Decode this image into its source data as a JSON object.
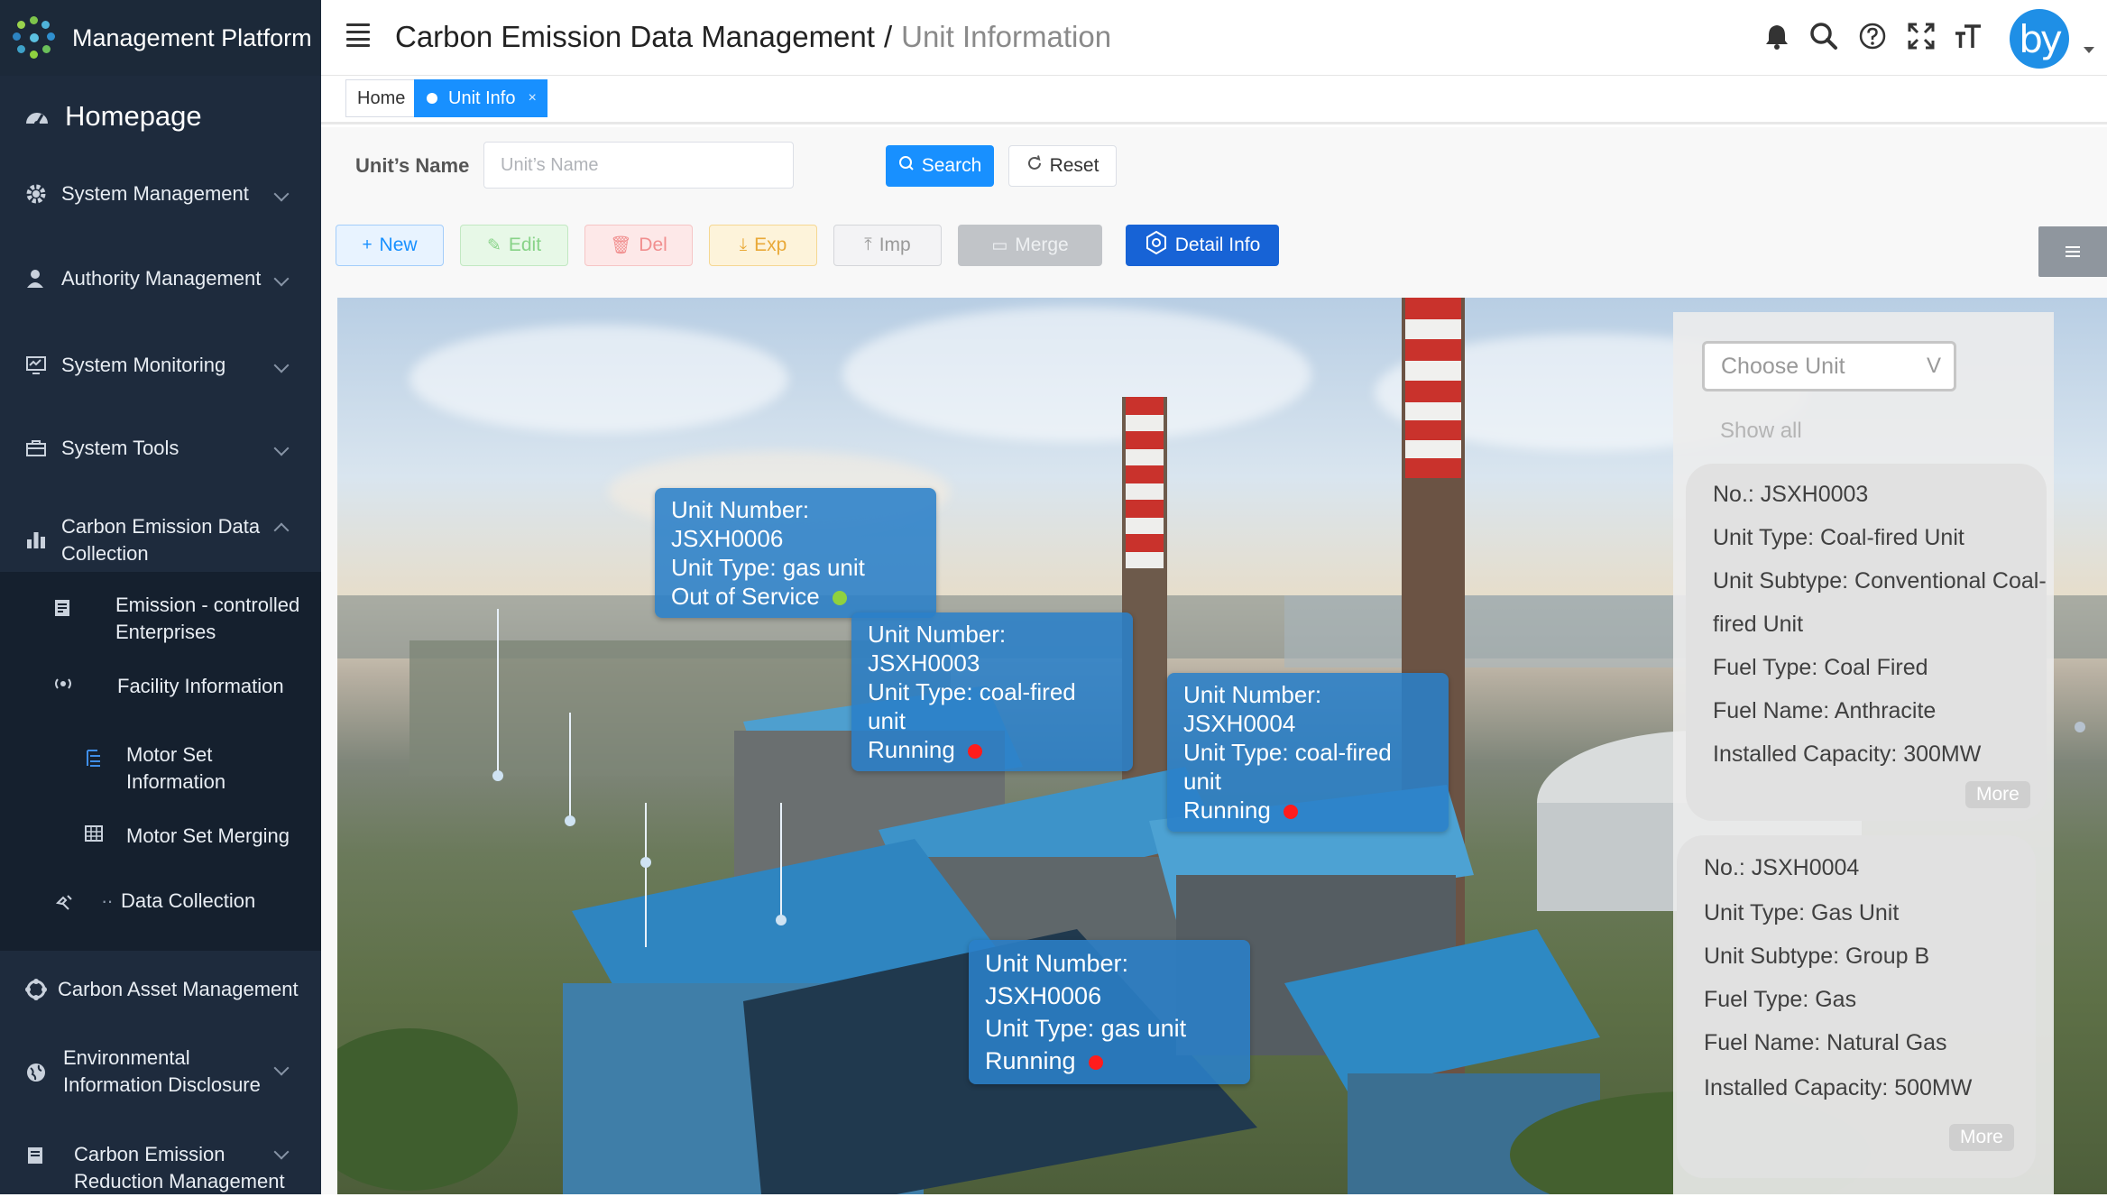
{
  "app": {
    "title": "Management Platform"
  },
  "sidebar": {
    "home": "Homepage",
    "items": [
      {
        "label": "System Management",
        "icon": "gear-icon"
      },
      {
        "label": "Authority Management",
        "icon": "user-icon"
      },
      {
        "label": "System Monitoring",
        "icon": "monitor-icon"
      },
      {
        "label": "System Tools",
        "icon": "toolbox-icon"
      },
      {
        "label": "Carbon Emission Data Collection",
        "icon": "bar-chart-icon"
      },
      {
        "label": "Carbon Asset Management",
        "icon": "asset-icon"
      },
      {
        "label": "Environmental Information Disclosure",
        "icon": "globe-icon"
      },
      {
        "label": "Carbon Emission Reduction Management",
        "icon": "report-icon"
      }
    ],
    "sub_items": [
      {
        "label": "Emission - controlled Enterprises",
        "icon": "enterprise-icon"
      },
      {
        "label": "Facility Information",
        "icon": "facility-icon"
      },
      {
        "label": "Motor Set Information",
        "icon": "list-icon"
      },
      {
        "label": "Motor Set Merging",
        "icon": "grid-icon"
      },
      {
        "label": "Data Collection",
        "icon": "collect-icon"
      }
    ]
  },
  "header": {
    "breadcrumb_parent": "Carbon Emission Data Management",
    "breadcrumb_sep": "/",
    "breadcrumb_current": "Unit Information",
    "avatar_text": "by"
  },
  "tags": {
    "home": "Home",
    "active": "Unit Info",
    "close": "×"
  },
  "query": {
    "label": "Unit’s Name",
    "placeholder": "Unit’s Name",
    "search": "Search",
    "reset": "Reset"
  },
  "toolbar": {
    "new": "New",
    "edit": "Edit",
    "del": "Del",
    "exp": "Exp",
    "imp": "Imp",
    "merge": "Merge",
    "detail": "Detail Info"
  },
  "callouts": [
    {
      "number": "Unit Number: JSXH0006",
      "type": "Unit Type: gas unit",
      "status": "Out of Service",
      "status_color": "#8fd13f"
    },
    {
      "number": "Unit Number: JSXH0003",
      "type": "Unit Type: coal-fired unit",
      "status": "Running",
      "status_color": "#ff1c1c"
    },
    {
      "number": "Unit Number: JSXH0004",
      "type": "Unit Type: coal-fired unit",
      "status": "Running",
      "status_color": "#ff1c1c"
    },
    {
      "number": "Unit Number: JSXH0006",
      "type": "Unit Type: gas unit",
      "status": "Running",
      "status_color": "#ff1c1c"
    }
  ],
  "panel": {
    "choose": "Choose Unit",
    "choose_caret": "V",
    "show_all": "Show all",
    "cards": [
      {
        "no": "No.:  JSXH0003",
        "type": "Unit Type: Coal-fired Unit",
        "subtype_line1": "Unit Subtype: Conventional Coal-",
        "subtype_line2": "fired Unit",
        "fuel_type": "Fuel Type: Coal Fired",
        "fuel_name": "Fuel Name: Anthracite",
        "capacity": "Installed Capacity: 300MW",
        "more": "More"
      },
      {
        "no": "No.: JSXH0004",
        "type": "Unit Type: Gas Unit",
        "subtype_line1": "Unit Subtype: Group B",
        "fuel_type": "Fuel Type: Gas",
        "fuel_name": "Fuel Name: Natural Gas",
        "capacity": "Installed Capacity: 500MW",
        "more": "More"
      }
    ]
  }
}
